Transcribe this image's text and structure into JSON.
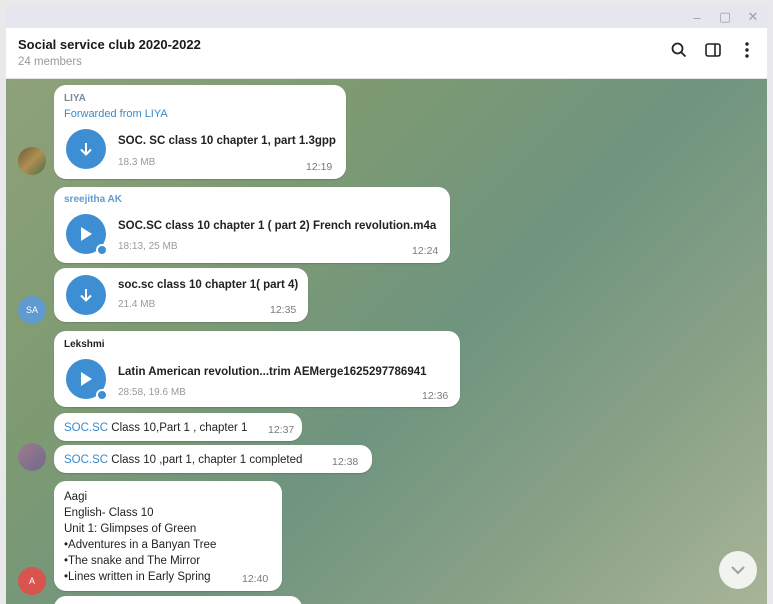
{
  "window": {
    "controls": [
      "–",
      "▢",
      "✕"
    ]
  },
  "header": {
    "title": "Social service club 2020-2022",
    "subtitle": "24 members",
    "icons": [
      "search-icon",
      "sidebar-toggle-icon",
      "more-vert-icon"
    ]
  },
  "avatars": {
    "sa_initials": "SA",
    "a_initials": "A"
  },
  "messages": {
    "m1": {
      "sender": "LIYA",
      "forwarded": "Forwarded from LIYA",
      "file_name": "SOC. SC class 10 chapter 1, part 1.3gpp",
      "file_size": "18.3 MB",
      "time": "12:19"
    },
    "m2": {
      "sender": "sreejitha AK",
      "file_name": "SOC.SC class 10 chapter 1 ( part 2) French revolution.m4a",
      "file_size": "18:13, 25 MB",
      "time": "12:24"
    },
    "m3": {
      "file_name": "soc.sc class 10 chapter 1( part 4)",
      "file_size": "21.4 MB",
      "time": "12:35"
    },
    "m4": {
      "sender": "Lekshmi",
      "file_name": "Latin American revolution...trim AEMerge1625297786941",
      "file_size": "28:58, 19.6 MB",
      "time": "12:36"
    },
    "m5": {
      "tag": "SOC.SC",
      "text": " Class 10,Part 1 , chapter 1",
      "time": "12:37"
    },
    "m6": {
      "tag": "SOC.SC",
      "text": " Class 10 ,part 1, chapter 1 completed",
      "time": "12:38"
    },
    "m7": {
      "sender": "Aagi",
      "lines": [
        "English- Class 10",
        "Unit 1: Glimpses of Green",
        "•Adventures in a Banyan Tree",
        "•The snake and The Mirror",
        "•Lines written in Early Spring"
      ],
      "time": "12:40"
    }
  },
  "colors": {
    "accent": "#3d8ed2",
    "liya": "#7b8a99",
    "sreejitha": "#5f9bd1",
    "lekshmi": "#222222",
    "aagi": "#222222"
  }
}
